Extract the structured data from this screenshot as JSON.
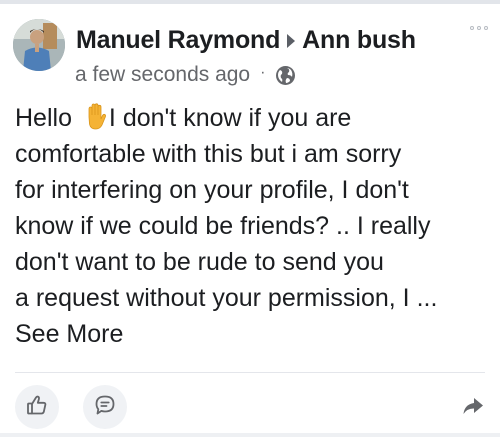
{
  "post": {
    "author": "Manuel Raymond",
    "target": "Ann bush",
    "timestamp": "a few seconds ago",
    "separator": "·",
    "privacy_icon": "globe-icon",
    "text_before_emoji": "Hello ",
    "emoji": "raised-hand",
    "text_after_emoji": "I don't know if you are\ncomfortable with this but i am sorry\nfor interfering on your profile, I don't\nknow if we could be friends? .. I really\ndon't want to be rude to send you\na request without your permission, I ...",
    "see_more_label": "See More"
  },
  "actions": {
    "like_icon": "thumbs-up-icon",
    "comment_icon": "comment-icon",
    "share_icon": "share-arrow-icon"
  },
  "colors": {
    "text": "#1c1e21",
    "secondary_text": "#65676b",
    "icon": "#65676b",
    "action_bg": "#f0f2f5"
  }
}
